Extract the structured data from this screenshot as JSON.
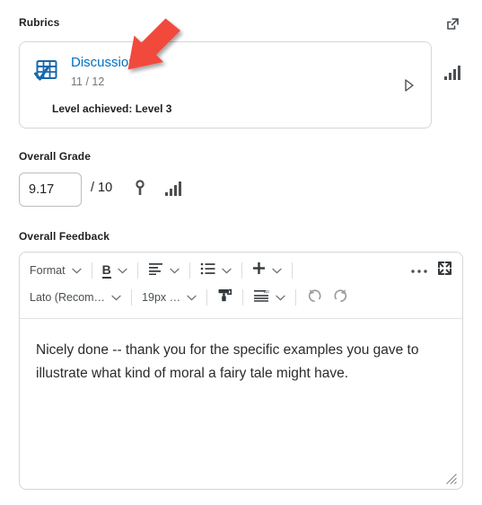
{
  "rubrics": {
    "section_label": "Rubrics",
    "expand_icon": "external-link-icon",
    "card": {
      "icon": "rubric-grid-check-icon",
      "title": "Discussions",
      "score": "11 / 12",
      "level_achieved": "Level achieved: Level 3",
      "expand_icon": "chevron-right-triangle-icon",
      "stats_icon": "bar-chart-icon"
    }
  },
  "overall_grade": {
    "section_label": "Overall Grade",
    "value": "9.17",
    "placeholder": "",
    "denominator": "/ 10",
    "key_icon": "key-icon",
    "stats_icon": "bar-chart-icon"
  },
  "overall_feedback": {
    "section_label": "Overall Feedback",
    "toolbar_row1": [
      {
        "type": "dropdown",
        "name": "format-dropdown",
        "label": "Format"
      },
      {
        "type": "sep"
      },
      {
        "type": "dropdown-icon",
        "name": "bold-dropdown",
        "icon": "bold-icon",
        "label": "B"
      },
      {
        "type": "sep"
      },
      {
        "type": "dropdown-icon",
        "name": "align-dropdown",
        "icon": "align-left-icon"
      },
      {
        "type": "sep"
      },
      {
        "type": "dropdown-icon",
        "name": "list-dropdown",
        "icon": "bulleted-list-icon"
      },
      {
        "type": "sep"
      },
      {
        "type": "dropdown-icon",
        "name": "insert-dropdown",
        "icon": "plus-icon"
      },
      {
        "type": "sep"
      },
      {
        "type": "button",
        "name": "more-options-button",
        "icon": "ellipsis-icon"
      },
      {
        "type": "button",
        "name": "fullscreen-button",
        "icon": "expand-arrows-icon"
      }
    ],
    "toolbar_row2": [
      {
        "type": "dropdown",
        "name": "font-family-dropdown",
        "label": "Lato (Recom…"
      },
      {
        "type": "sep"
      },
      {
        "type": "dropdown",
        "name": "font-size-dropdown",
        "label": "19px …"
      },
      {
        "type": "sep"
      },
      {
        "type": "button",
        "name": "format-painter-button",
        "icon": "format-painter-icon"
      },
      {
        "type": "sep"
      },
      {
        "type": "dropdown-icon",
        "name": "line-spacing-dropdown",
        "icon": "line-spacing-icon"
      },
      {
        "type": "sep"
      },
      {
        "type": "button",
        "name": "undo-button",
        "icon": "undo-icon"
      },
      {
        "type": "button",
        "name": "redo-button",
        "icon": "redo-icon"
      }
    ],
    "labels": {
      "format": "Format",
      "bold": "B",
      "font_family": "Lato (Recom…",
      "font_size": "19px …"
    },
    "text_value": "Nicely done -- thank you for the specific examples you gave to illustrate what kind of moral a fairy tale might have.",
    "text_placeholder": "",
    "resize_grip": "resize-grip-icon"
  },
  "annotation": {
    "arrow": "red-arrow-pointing-down-left",
    "color": "#f2493d"
  },
  "colors": {
    "link_blue": "#006fbf",
    "border_gray": "#d6d6d6",
    "muted_text": "#767676",
    "icon_gray": "#4b4f52",
    "annotation_red": "#f2493d"
  }
}
